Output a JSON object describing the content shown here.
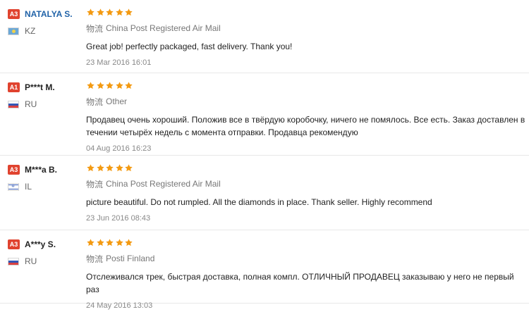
{
  "reviews": [
    {
      "badge": "A3",
      "name": "NATALYA S.",
      "country": "KZ",
      "flag": "kz",
      "stars": 5,
      "logistics_label": "物流",
      "logistics": "China Post Registered Air Mail",
      "comment": "Great job! perfectly packaged, fast delivery. Thank you!",
      "date": "23 Mar 2016 16:01"
    },
    {
      "badge": "A1",
      "name": "P***t M.",
      "country": "RU",
      "flag": "ru",
      "stars": 5,
      "logistics_label": "物流",
      "logistics": "Other",
      "comment": "Продавец очень хороший. Положив все в твёрдую коробочку, ничего не помялось. Все есть. Заказ доставлен в течении четырёх недель с момента отправки. Продавца рекомендую",
      "date": "04 Aug 2016 16:23"
    },
    {
      "badge": "A3",
      "name": "M***a B.",
      "country": "IL",
      "flag": "il",
      "stars": 5,
      "logistics_label": "物流",
      "logistics": "China Post Registered Air Mail",
      "comment": "picture beautiful. Do not rumpled. All the diamonds in place. Thank seller. Highly recommend",
      "date": "23 Jun 2016 08:43"
    },
    {
      "badge": "A3",
      "name": "A***y S.",
      "country": "RU",
      "flag": "ru",
      "stars": 5,
      "logistics_label": "物流",
      "logistics": "Posti Finland",
      "comment": "Отслеживался трек, быстрая доставка, полная компл. ОТЛИЧНЫЙ ПРОДАВЕЦ заказываю у него не первый раз",
      "date": "24 May 2016 13:03"
    }
  ],
  "colors": {
    "badge": "#e0432f",
    "star": "#f39a12",
    "first_name": "#2163a8"
  }
}
